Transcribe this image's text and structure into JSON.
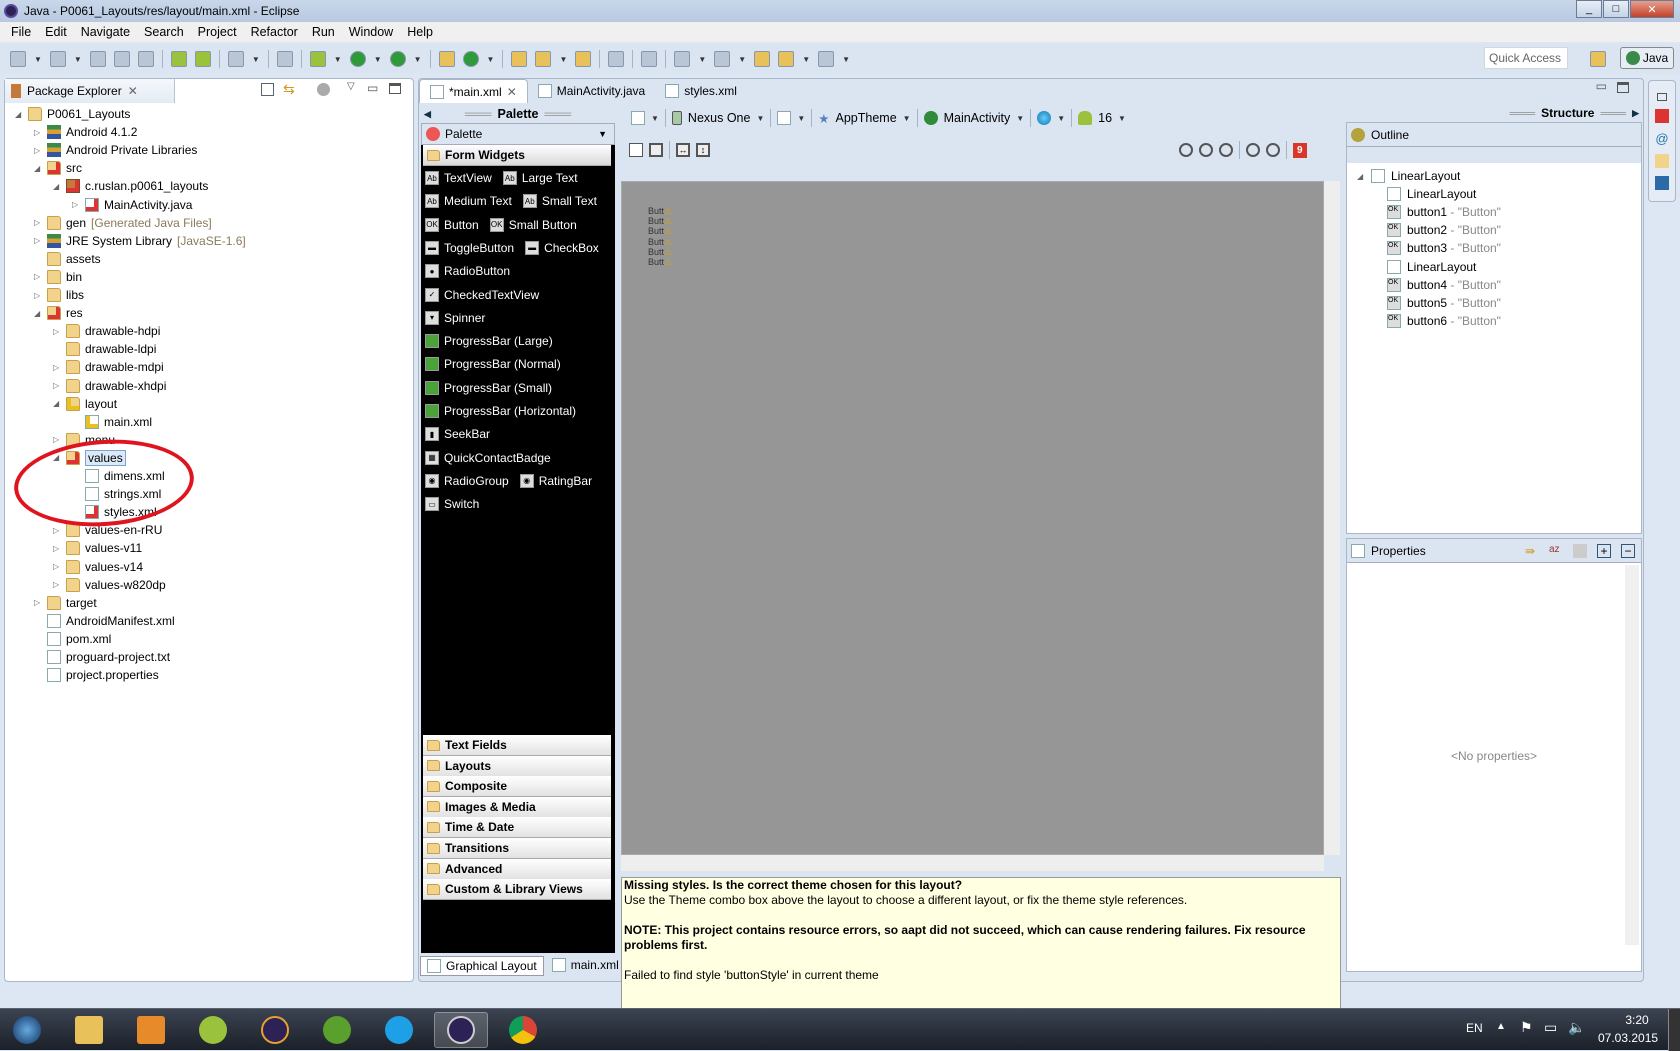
{
  "window": {
    "title": "Java - P0061_Layouts/res/layout/main.xml - Eclipse",
    "controls": [
      "_",
      "□",
      "✕"
    ]
  },
  "menu": [
    "File",
    "Edit",
    "Navigate",
    "Search",
    "Project",
    "Refactor",
    "Run",
    "Window",
    "Help"
  ],
  "toolbar": {
    "quick_access_placeholder": "Quick Access",
    "perspective": "Java"
  },
  "package_explorer": {
    "title": "Package Explorer",
    "items": [
      {
        "label": "P0061_Layouts",
        "indent": 0,
        "twisty": "open",
        "icon": "project"
      },
      {
        "label": "Android 4.1.2",
        "indent": 1,
        "twisty": "closed",
        "icon": "library"
      },
      {
        "label": "Android Private Libraries",
        "indent": 1,
        "twisty": "closed",
        "icon": "library"
      },
      {
        "label": "src",
        "indent": 1,
        "twisty": "open",
        "icon": "source-folder-error"
      },
      {
        "label": "c.ruslan.p0061_layouts",
        "indent": 2,
        "twisty": "open",
        "icon": "package-error"
      },
      {
        "label": "MainActivity.java",
        "indent": 3,
        "twisty": "closed",
        "icon": "java-file-error"
      },
      {
        "label": "gen",
        "deco": "[Generated Java Files]",
        "indent": 1,
        "twisty": "closed",
        "icon": "source-folder"
      },
      {
        "label": "JRE System Library",
        "deco": "[JavaSE-1.6]",
        "indent": 1,
        "twisty": "closed",
        "icon": "library"
      },
      {
        "label": "assets",
        "indent": 1,
        "twisty": "",
        "icon": "folder"
      },
      {
        "label": "bin",
        "indent": 1,
        "twisty": "closed",
        "icon": "folder"
      },
      {
        "label": "libs",
        "indent": 1,
        "twisty": "closed",
        "icon": "folder"
      },
      {
        "label": "res",
        "indent": 1,
        "twisty": "open",
        "icon": "folder-error"
      },
      {
        "label": "drawable-hdpi",
        "indent": 2,
        "twisty": "closed",
        "icon": "folder"
      },
      {
        "label": "drawable-ldpi",
        "indent": 2,
        "twisty": "",
        "icon": "folder"
      },
      {
        "label": "drawable-mdpi",
        "indent": 2,
        "twisty": "closed",
        "icon": "folder"
      },
      {
        "label": "drawable-xhdpi",
        "indent": 2,
        "twisty": "closed",
        "icon": "folder"
      },
      {
        "label": "layout",
        "indent": 2,
        "twisty": "open",
        "icon": "folder-warning"
      },
      {
        "label": "main.xml",
        "indent": 3,
        "twisty": "",
        "icon": "xml-file-warning"
      },
      {
        "label": "menu",
        "indent": 2,
        "twisty": "closed",
        "icon": "folder"
      },
      {
        "label": "values",
        "indent": 2,
        "twisty": "open",
        "icon": "folder-error",
        "selected": true
      },
      {
        "label": "dimens.xml",
        "indent": 3,
        "twisty": "",
        "icon": "xml-file"
      },
      {
        "label": "strings.xml",
        "indent": 3,
        "twisty": "",
        "icon": "xml-file"
      },
      {
        "label": "styles.xml",
        "indent": 3,
        "twisty": "",
        "icon": "xml-file-error"
      },
      {
        "label": "values-en-rRU",
        "indent": 2,
        "twisty": "closed",
        "icon": "folder"
      },
      {
        "label": "values-v11",
        "indent": 2,
        "twisty": "closed",
        "icon": "folder"
      },
      {
        "label": "values-v14",
        "indent": 2,
        "twisty": "closed",
        "icon": "folder"
      },
      {
        "label": "values-w820dp",
        "indent": 2,
        "twisty": "closed",
        "icon": "folder"
      },
      {
        "label": "target",
        "indent": 1,
        "twisty": "closed",
        "icon": "folder"
      },
      {
        "label": "AndroidManifest.xml",
        "indent": 1,
        "twisty": "",
        "icon": "xml-file"
      },
      {
        "label": "pom.xml",
        "indent": 1,
        "twisty": "",
        "icon": "maven-file"
      },
      {
        "label": "proguard-project.txt",
        "indent": 1,
        "twisty": "",
        "icon": "text-file"
      },
      {
        "label": "project.properties",
        "indent": 1,
        "twisty": "",
        "icon": "text-file"
      }
    ]
  },
  "editor": {
    "tabs": [
      {
        "label": "*main.xml",
        "active": true
      },
      {
        "label": "MainActivity.java"
      },
      {
        "label": "styles.xml"
      }
    ],
    "palette": {
      "header": "Palette",
      "dropdown": "Palette",
      "section": "Form Widgets",
      "widgets": [
        [
          "TextView",
          "Large Text"
        ],
        [
          "Medium Text",
          "Small Text"
        ],
        [
          "Button",
          "Small Button"
        ],
        [
          "ToggleButton",
          "CheckBox"
        ],
        [
          "RadioButton"
        ],
        [
          "CheckedTextView"
        ],
        [
          "Spinner"
        ],
        [
          "ProgressBar (Large)"
        ],
        [
          "ProgressBar (Normal)"
        ],
        [
          "ProgressBar (Small)"
        ],
        [
          "ProgressBar (Horizontal)"
        ],
        [
          "SeekBar"
        ],
        [
          "QuickContactBadge"
        ],
        [
          "RadioGroup",
          "RatingBar"
        ],
        [
          "Switch"
        ]
      ],
      "categories": [
        "Text Fields",
        "Layouts",
        "Composite",
        "Images & Media",
        "Time & Date",
        "Transitions",
        "Advanced",
        "Custom & Library Views"
      ]
    },
    "config": {
      "device": "Nexus One",
      "theme": "AppTheme",
      "activity": "MainActivity",
      "api": "16",
      "error_count": "9"
    },
    "canvas_buttons": [
      "Butt",
      "Butt",
      "Butt",
      "Butt",
      "Butt",
      "Butt"
    ],
    "error": {
      "title": "Missing styles. Is the correct theme chosen for this layout?",
      "line1": "Use the Theme combo box above the layout to choose a different layout, or fix the theme style references.",
      "note": "NOTE: This project contains resource errors, so aapt did not succeed, which can cause rendering failures. Fix resource problems first.",
      "failed": "Failed to find style 'buttonStyle' in current theme"
    },
    "bottom_tabs": [
      "Graphical Layout",
      "main.xml"
    ]
  },
  "structure": {
    "header": "Structure",
    "outline_title": "Outline",
    "outline": [
      {
        "label": "LinearLayout",
        "indent": 0
      },
      {
        "label": "LinearLayout",
        "indent": 1
      },
      {
        "label": "button1",
        "text": " - \"Button\"",
        "indent": 1
      },
      {
        "label": "button2",
        "text": " - \"Button\"",
        "indent": 1
      },
      {
        "label": "button3",
        "text": " - \"Button\"",
        "indent": 1
      },
      {
        "label": "LinearLayout",
        "indent": 1
      },
      {
        "label": "button4",
        "text": " - \"Button\"",
        "indent": 1
      },
      {
        "label": "button5",
        "text": " - \"Button\"",
        "indent": 1
      },
      {
        "label": "button6",
        "text": " - \"Button\"",
        "indent": 1
      }
    ],
    "properties_title": "Properties",
    "no_properties": "<No properties>"
  },
  "taskbar": {
    "lang": "EN",
    "time": "3:20",
    "date": "07.03.2015"
  },
  "colors": {
    "accent": "#e0141e",
    "error_bg": "#ffffe1",
    "palette_bg": "#000000",
    "canvas_bg": "#969696"
  }
}
